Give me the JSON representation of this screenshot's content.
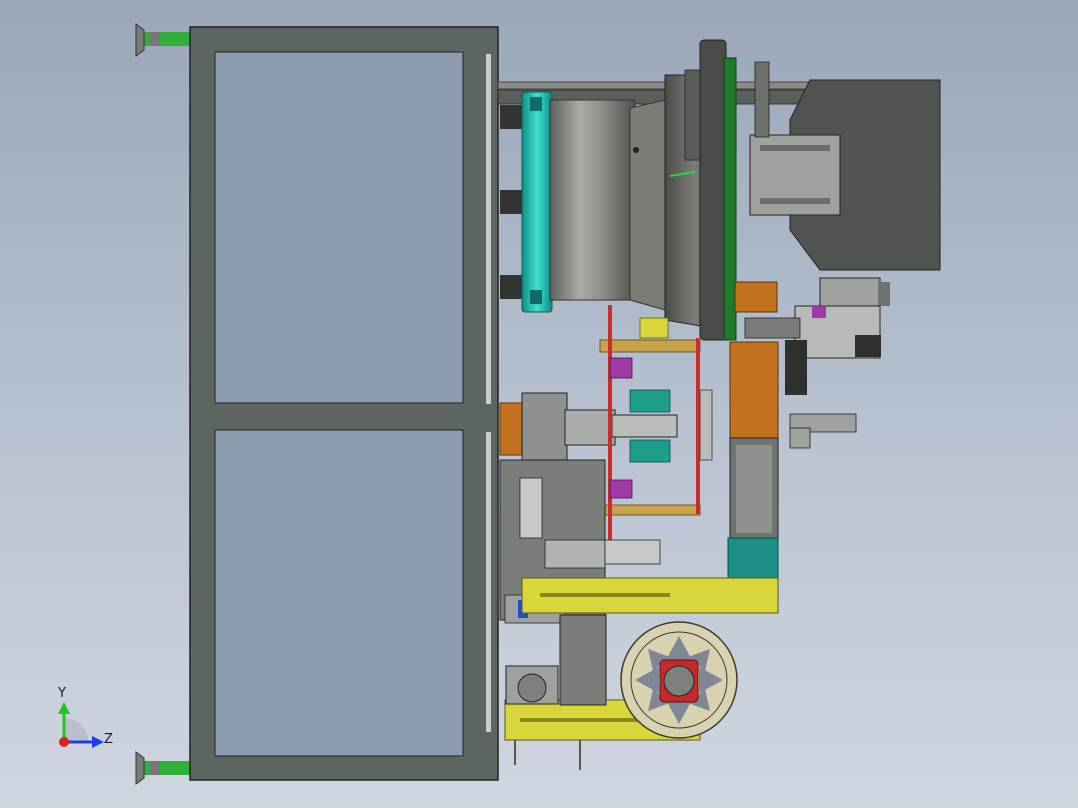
{
  "view": {
    "triad_labels": {
      "y": "Y",
      "z": "Z"
    }
  },
  "colors": {
    "background_top": "#9aa7b9",
    "frame": "#5e6661",
    "frame_panel": "#8c9bb0",
    "drum": "#8b8d86",
    "drum_ring": "#20c7b8",
    "green_flange": "#1e7a2c",
    "yellow_plate": "#d8d63a",
    "orange_block": "#c2721e",
    "purple_block": "#a03aa6",
    "red_frame": "#d02a2a",
    "wheel": "#d9d2b0",
    "axis_y": "#22c522",
    "axis_z": "#1e3fe0",
    "axis_x": "#e02020"
  }
}
